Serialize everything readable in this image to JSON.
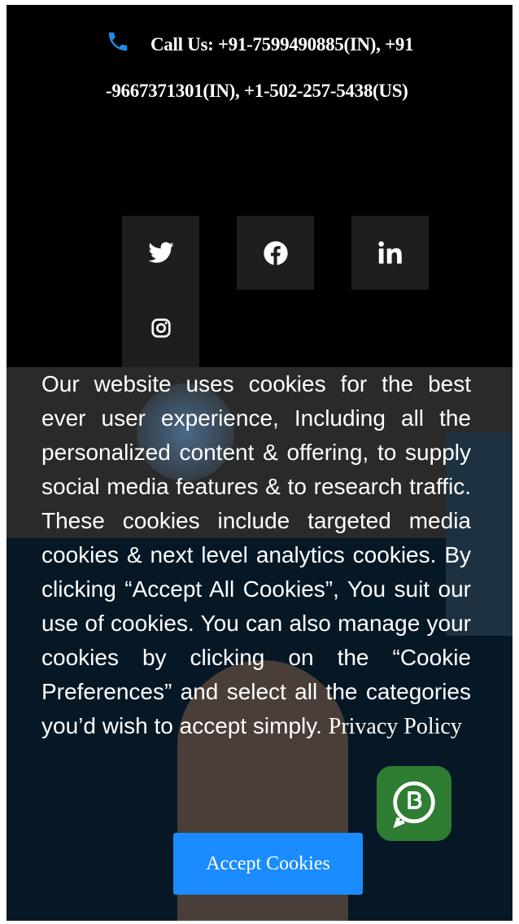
{
  "contact": {
    "label": "Call Us:",
    "numbers": "+91-7599490885(IN), +91-9667371301(IN), +1-502-257-5438(US)",
    "icon": "phone-icon",
    "icon_color": "#1e88e5"
  },
  "social": [
    {
      "name": "twitter",
      "icon": "twitter-icon"
    },
    {
      "name": "facebook",
      "icon": "facebook-icon"
    },
    {
      "name": "linkedin",
      "icon": "linkedin-icon"
    },
    {
      "name": "instagram",
      "icon": "instagram-icon"
    }
  ],
  "cookie_banner": {
    "message": "Our website uses cookies for the best ever user experience, Including all the personalized content & offering, to supply social media features & to research traffic. These cookies include targeted media cookies & next level analytics cookies. By clicking “Accept All Cookies”, You suit our use of cookies. You can also manage your cookies by clicking on the “Cookie Preferences” and select all the categories you’d wish to accept simply.",
    "privacy_link": "Privacy Policy",
    "accept_label": "Accept Cookies",
    "accept_color": "#1a8cff"
  }
}
